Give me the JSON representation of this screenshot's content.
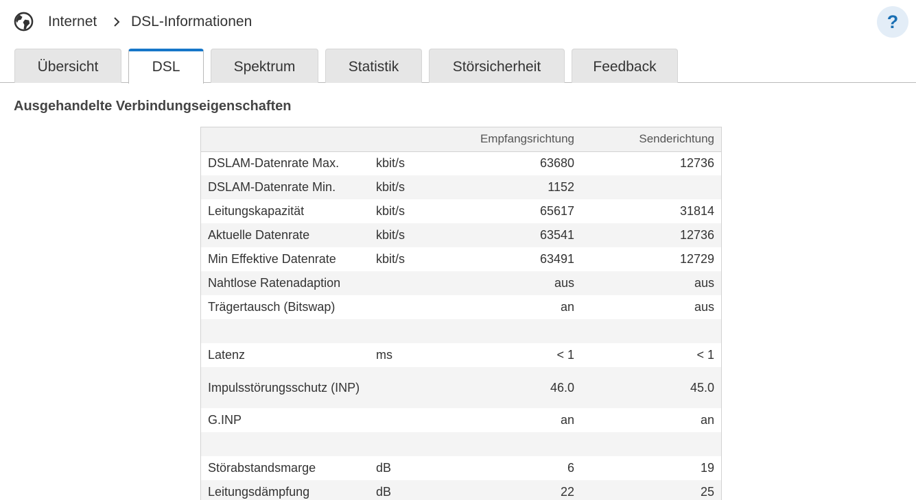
{
  "header": {
    "icon": "globe-icon",
    "breadcrumb": [
      "Internet",
      "DSL-Informationen"
    ],
    "help_label": "?"
  },
  "tabs": [
    {
      "label": "Übersicht",
      "active": false
    },
    {
      "label": "DSL",
      "active": true
    },
    {
      "label": "Spektrum",
      "active": false
    },
    {
      "label": "Statistik",
      "active": false
    },
    {
      "label": "Störsicherheit",
      "active": false
    },
    {
      "label": "Feedback",
      "active": false
    }
  ],
  "colors": {
    "accent": "#1677c9",
    "tab_bg": "#e6e6e6",
    "row_alt": "#f4f4f4"
  },
  "section": {
    "title": "Ausgehandelte Verbindungseigenschaften"
  },
  "table": {
    "columns": [
      "",
      "",
      "Empfangsrichtung",
      "Senderichtung"
    ],
    "rows": [
      {
        "label": "DSLAM-Datenrate Max.",
        "unit": "kbit/s",
        "rx": "63680",
        "tx": "12736"
      },
      {
        "label": "DSLAM-Datenrate Min.",
        "unit": "kbit/s",
        "rx": "1152",
        "tx": ""
      },
      {
        "label": "Leitungskapazität",
        "unit": "kbit/s",
        "rx": "65617",
        "tx": "31814"
      },
      {
        "label": "Aktuelle Datenrate",
        "unit": "kbit/s",
        "rx": "63541",
        "tx": "12736"
      },
      {
        "label": "Min Effektive Datenrate",
        "unit": "kbit/s",
        "rx": "63491",
        "tx": "12729"
      },
      {
        "label": "Nahtlose Ratenadaption",
        "unit": "",
        "rx": "aus",
        "tx": "aus"
      },
      {
        "label": "Trägertausch (Bitswap)",
        "unit": "",
        "rx": "an",
        "tx": "aus"
      },
      {
        "label": "",
        "unit": "",
        "rx": "",
        "tx": ""
      },
      {
        "label": "Latenz",
        "unit": "ms",
        "rx": "< 1",
        "tx": "< 1"
      },
      {
        "label": "Impulsstörungsschutz (INP)",
        "unit": "",
        "rx": "46.0",
        "tx": "45.0"
      },
      {
        "label": "G.INP",
        "unit": "",
        "rx": "an",
        "tx": "an"
      },
      {
        "label": "",
        "unit": "",
        "rx": "",
        "tx": ""
      },
      {
        "label": "Störabstandsmarge",
        "unit": "dB",
        "rx": "6",
        "tx": "19"
      },
      {
        "label": "Leitungsdämpfung",
        "unit": "dB",
        "rx": "22",
        "tx": "25"
      }
    ]
  }
}
